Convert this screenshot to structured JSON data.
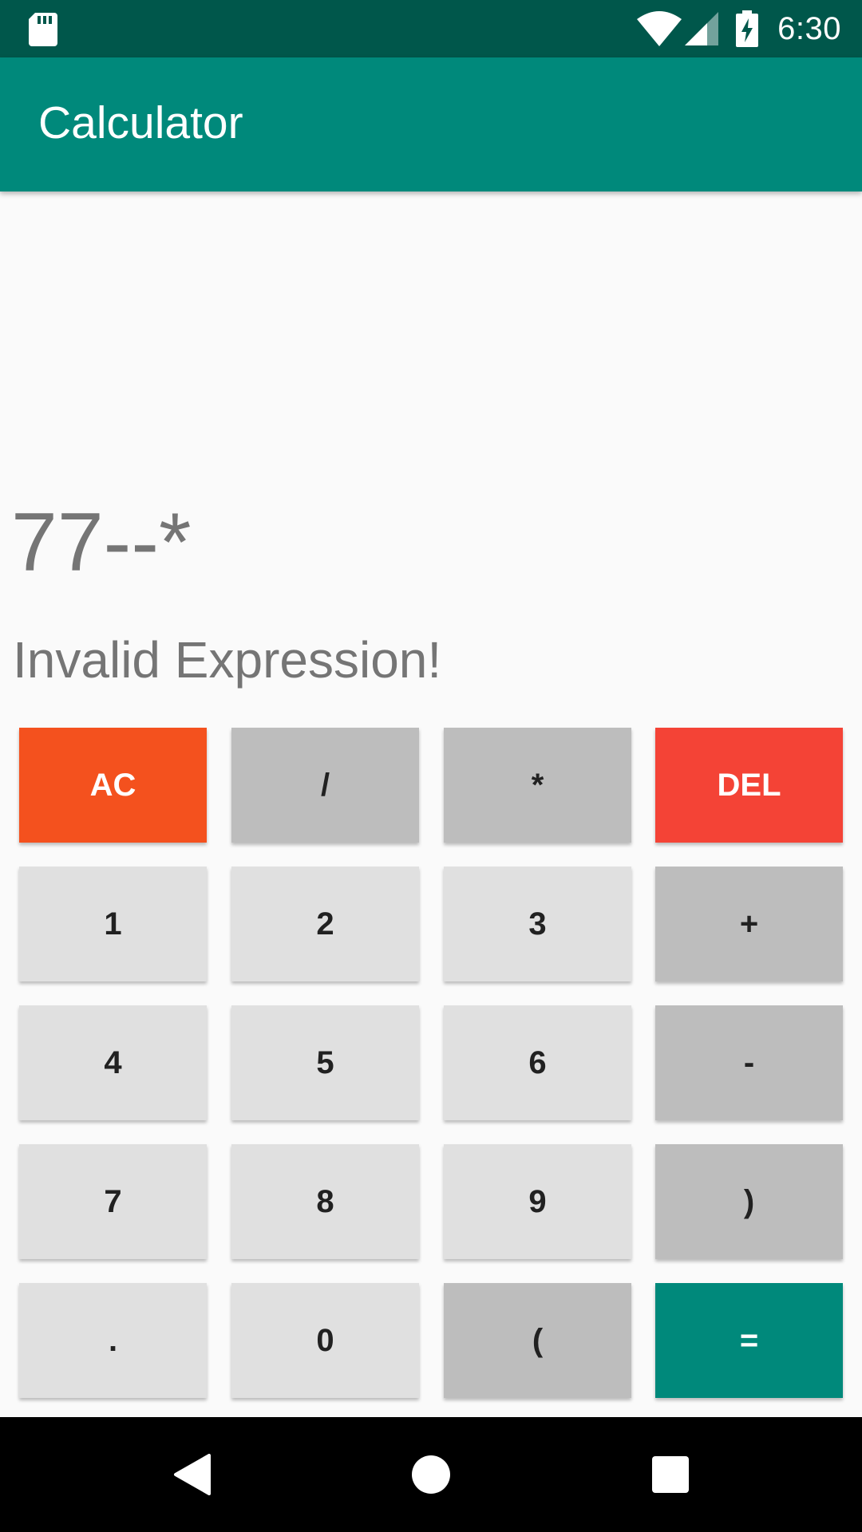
{
  "status_bar": {
    "time": "6:30",
    "icons": [
      "sd-card-icon",
      "wifi-icon",
      "signal-icon",
      "battery-charging-icon"
    ]
  },
  "app_bar": {
    "title": "Calculator"
  },
  "display": {
    "expression": "77--*",
    "result": "Invalid Expression!"
  },
  "keypad": {
    "ac": "AC",
    "divide": "/",
    "multiply": "*",
    "del": "DEL",
    "one": "1",
    "two": "2",
    "three": "3",
    "plus": "+",
    "four": "4",
    "five": "5",
    "six": "6",
    "minus": "-",
    "seven": "7",
    "eight": "8",
    "nine": "9",
    "close_paren": ")",
    "dot": ".",
    "zero": "0",
    "open_paren": "(",
    "equals": "="
  },
  "nav_bar": {
    "icons": [
      "back-icon",
      "home-icon",
      "recent-apps-icon"
    ]
  },
  "colors": {
    "status_bar": "#00574b",
    "app_bar": "#00897b",
    "ac_button": "#f4511e",
    "del_button": "#f44336",
    "equals_button": "#00897b",
    "digit_button": "#e0e0e0",
    "operator_button": "#bdbdbd"
  }
}
